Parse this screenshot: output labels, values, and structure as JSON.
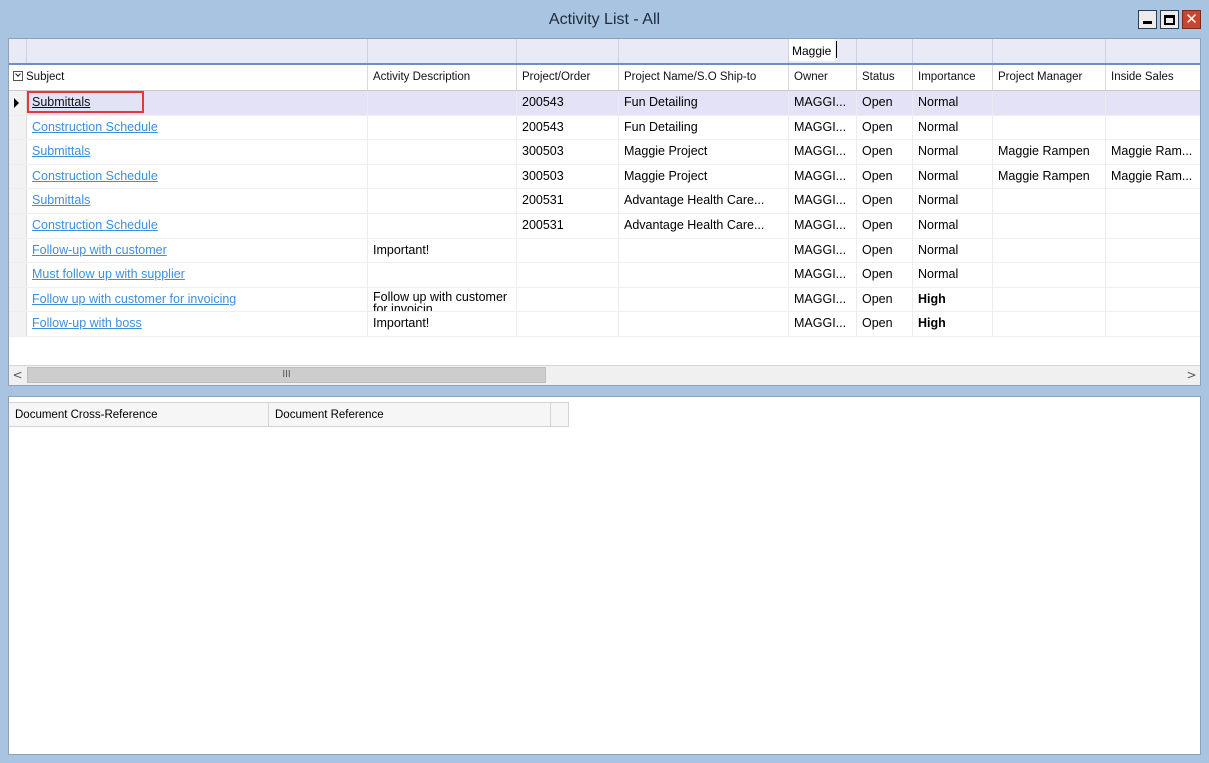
{
  "window": {
    "title": "Activity List - All"
  },
  "filter": {
    "owner_value": "Maggie"
  },
  "columns": [
    "Subject",
    "Activity Description",
    "Project/Order",
    "Project Name/S.O Ship-to",
    "Owner",
    "Status",
    "Importance",
    "Project Manager",
    "Inside Sales"
  ],
  "rows": [
    {
      "subject": "Submittals",
      "description": "",
      "project_order": "200543",
      "project_name": "Fun Detailing",
      "owner": "MAGGI...",
      "status": "Open",
      "importance": "Normal",
      "project_manager": "",
      "inside_sales": ""
    },
    {
      "subject": "Construction Schedule",
      "description": "",
      "project_order": "200543",
      "project_name": "Fun Detailing",
      "owner": "MAGGI...",
      "status": "Open",
      "importance": "Normal",
      "project_manager": "",
      "inside_sales": ""
    },
    {
      "subject": "Submittals",
      "description": "",
      "project_order": "300503",
      "project_name": "Maggie Project",
      "owner": "MAGGI...",
      "status": "Open",
      "importance": "Normal",
      "project_manager": "Maggie Rampen",
      "inside_sales": "Maggie Ram..."
    },
    {
      "subject": "Construction Schedule",
      "description": "",
      "project_order": "300503",
      "project_name": "Maggie Project",
      "owner": "MAGGI...",
      "status": "Open",
      "importance": "Normal",
      "project_manager": "Maggie Rampen",
      "inside_sales": "Maggie Ram..."
    },
    {
      "subject": "Submittals",
      "description": "",
      "project_order": "200531",
      "project_name": "Advantage Health Care...",
      "owner": "MAGGI...",
      "status": "Open",
      "importance": "Normal",
      "project_manager": "",
      "inside_sales": ""
    },
    {
      "subject": "Construction Schedule",
      "description": "",
      "project_order": "200531",
      "project_name": "Advantage Health Care...",
      "owner": "MAGGI...",
      "status": "Open",
      "importance": "Normal",
      "project_manager": "",
      "inside_sales": ""
    },
    {
      "subject": "Follow-up with customer",
      "description": "Important!",
      "project_order": "",
      "project_name": "",
      "owner": "MAGGI...",
      "status": "Open",
      "importance": "Normal",
      "project_manager": "",
      "inside_sales": ""
    },
    {
      "subject": "Must follow up with supplier",
      "description": "",
      "project_order": "",
      "project_name": "",
      "owner": "MAGGI...",
      "status": "Open",
      "importance": "Normal",
      "project_manager": "",
      "inside_sales": ""
    },
    {
      "subject": "Follow up with customer for invoicing",
      "description": "Follow up with customer for invoicin",
      "project_order": "",
      "project_name": "",
      "owner": "MAGGI...",
      "status": "Open",
      "importance": "High",
      "project_manager": "",
      "inside_sales": ""
    },
    {
      "subject": "Follow-up with boss",
      "description": "Important!",
      "project_order": "",
      "project_name": "",
      "owner": "MAGGI...",
      "status": "Open",
      "importance": "High",
      "project_manager": "",
      "inside_sales": ""
    }
  ],
  "scrollbar": {
    "left_arrow": "<",
    "right_arrow": ">",
    "thumb_grip": "III"
  },
  "xref": {
    "columns": [
      "Document Cross-Reference",
      "Document Reference"
    ]
  },
  "icons": {
    "minimize": "minimize-icon",
    "maximize": "maximize-icon",
    "close": "close-icon",
    "column-chooser": "chevron-down-icon",
    "row-selector": "current-row-arrow-icon"
  },
  "colors": {
    "window_frame": "#a8c4e0",
    "link": "#3d8fdc",
    "selected_row": "#e4e2f6",
    "focus_outline": "#e03a3a",
    "close_button": "#c9452e"
  }
}
